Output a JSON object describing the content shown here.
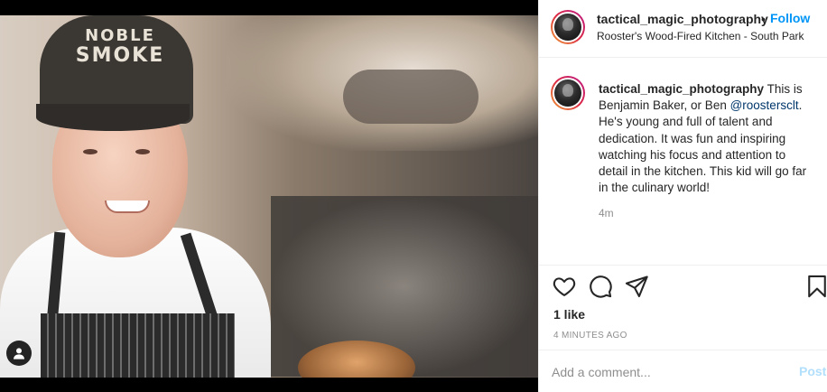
{
  "post": {
    "author": "tactical_magic_photography",
    "location": "Rooster's Wood-Fired Kitchen - South Park",
    "follow_separator": "•",
    "follow_label": "Follow",
    "photo_cap_text_line1": "NOBLE",
    "photo_cap_text_line2": "SMOKE"
  },
  "caption": {
    "author": "tactical_magic_photography",
    "text_before": " This is Benjamin Baker, or Ben ",
    "mention": "@roostersclt",
    "text_after": ". He's young and full of talent and dedication. It was fun and inspiring watching his focus and attention to detail in the kitchen. This kid will go far in the culinary world!",
    "time": "4m"
  },
  "actions": {
    "icons": [
      "heart-icon",
      "comment-icon",
      "share-icon",
      "bookmark-icon"
    ]
  },
  "stats": {
    "likes": "1 like",
    "posted": "4 MINUTES AGO"
  },
  "comment": {
    "placeholder": "Add a comment...",
    "post_label": "Post"
  },
  "colors": {
    "link_blue": "#0095f6",
    "mention": "#00376b",
    "muted": "#8e8e8e",
    "post_disabled": "#b2dffc"
  }
}
